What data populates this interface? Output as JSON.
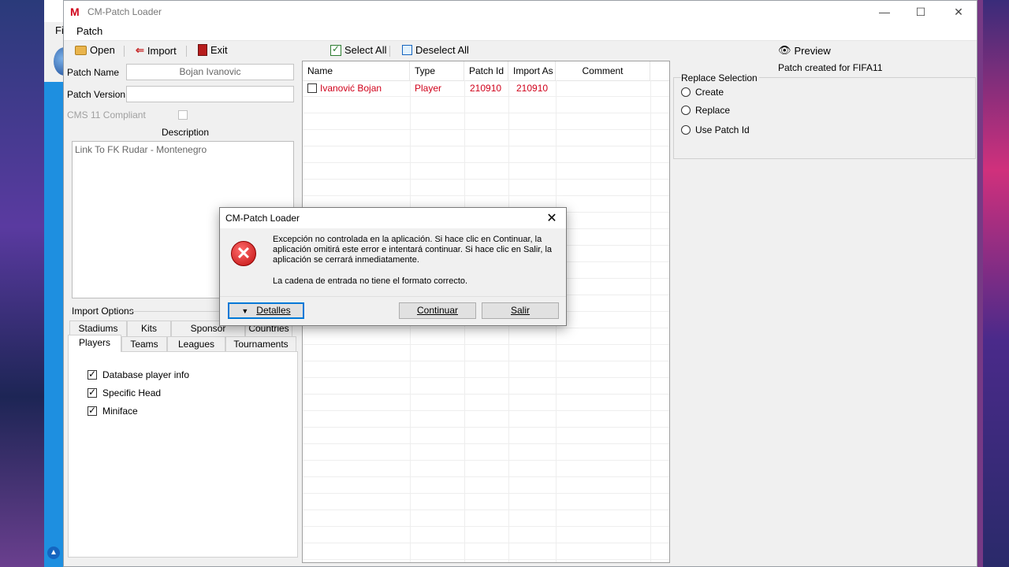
{
  "back_window": {
    "menu_label": "Fi"
  },
  "window": {
    "title": "CM-Patch Loader",
    "controls": {
      "minimize": "—",
      "maximize": "☐",
      "close": "✕"
    }
  },
  "menu": {
    "patch": "Patch"
  },
  "toolbar": {
    "open": "Open",
    "import": "Import",
    "exit": "Exit",
    "select_all": "Select All",
    "deselect_all": "Deselect All",
    "preview": "Preview"
  },
  "form": {
    "patch_name_label": "Patch Name",
    "patch_name_value": "Bojan Ivanovic",
    "patch_version_label": "Patch Version",
    "patch_version_value": "",
    "cms_compliant_label": "CMS 11 Compliant",
    "description_label": "Description",
    "description_value": "Link To FK Rudar - Montenegro"
  },
  "import_options": {
    "label": "Import Options",
    "tabs_back": [
      "Stadiums",
      "Kits",
      "Sponsor",
      "Countries"
    ],
    "tabs_front": [
      "Players",
      "Teams",
      "Leagues",
      "Tournaments"
    ],
    "active_tab": "Players",
    "options": [
      "Database player info",
      "Specific Head",
      "Miniface"
    ]
  },
  "list": {
    "columns": [
      "Name",
      "Type",
      "Patch Id",
      "Import As",
      "Comment"
    ],
    "rows": [
      {
        "name": "Ivanović Bojan",
        "type": "Player",
        "patch_id": "210910",
        "import_as": "210910",
        "comment": ""
      }
    ]
  },
  "right_panel": {
    "patch_created": "Patch created for FIFA11",
    "replace_selection_label": "Replace Selection",
    "radios": [
      "Create",
      "Replace",
      "Use Patch Id"
    ]
  },
  "dialog": {
    "title": "CM-Patch Loader",
    "close": "✕",
    "icon": "error-icon",
    "message": "Excepción no controlada en la aplicación. Si hace clic en Continuar, la aplicación omitirá este error e intentará continuar. Si hace clic en Salir, la aplicación se cerrará inmediatamente.",
    "detail": "La cadena de entrada no tiene el formato correcto.",
    "details_button": "Detalles",
    "continue_button": "Continuar",
    "exit_button": "Salir"
  },
  "colors": {
    "accent": "#0078d7",
    "error_red": "#d0021b"
  }
}
